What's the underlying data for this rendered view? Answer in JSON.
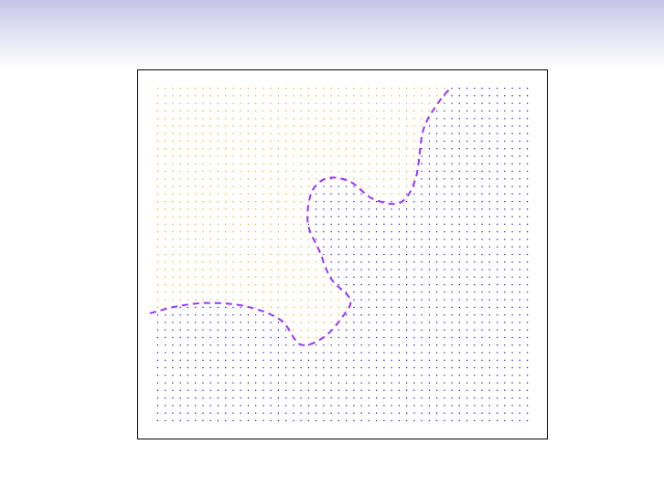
{
  "chart_data": {
    "type": "scatter",
    "title": "",
    "xlabel": "",
    "ylabel": "",
    "xlim": [
      0,
      1
    ],
    "ylim": [
      0,
      1
    ],
    "grid_points": {
      "nx": 50,
      "ny": 45,
      "xrange": [
        0.02,
        0.98
      ],
      "yrange": [
        0.02,
        0.98
      ]
    },
    "classes": [
      {
        "name": "",
        "color": "#ff9900",
        "region": "upper-left"
      },
      {
        "name": "",
        "color": "#0000cc",
        "region": "lower-right"
      }
    ],
    "decision_boundary": {
      "color": "#9933ff",
      "style": "dashed",
      "points": [
        [
          0.0,
          0.33
        ],
        [
          0.07,
          0.35
        ],
        [
          0.15,
          0.36
        ],
        [
          0.25,
          0.35
        ],
        [
          0.34,
          0.31
        ],
        [
          0.39,
          0.24
        ],
        [
          0.45,
          0.26
        ],
        [
          0.5,
          0.32
        ],
        [
          0.52,
          0.37
        ],
        [
          0.47,
          0.43
        ],
        [
          0.44,
          0.51
        ],
        [
          0.41,
          0.59
        ],
        [
          0.42,
          0.68
        ],
        [
          0.46,
          0.72
        ],
        [
          0.52,
          0.71
        ],
        [
          0.58,
          0.66
        ],
        [
          0.65,
          0.65
        ],
        [
          0.69,
          0.72
        ],
        [
          0.71,
          0.86
        ],
        [
          0.75,
          0.94
        ],
        [
          0.78,
          0.98
        ]
      ]
    }
  }
}
